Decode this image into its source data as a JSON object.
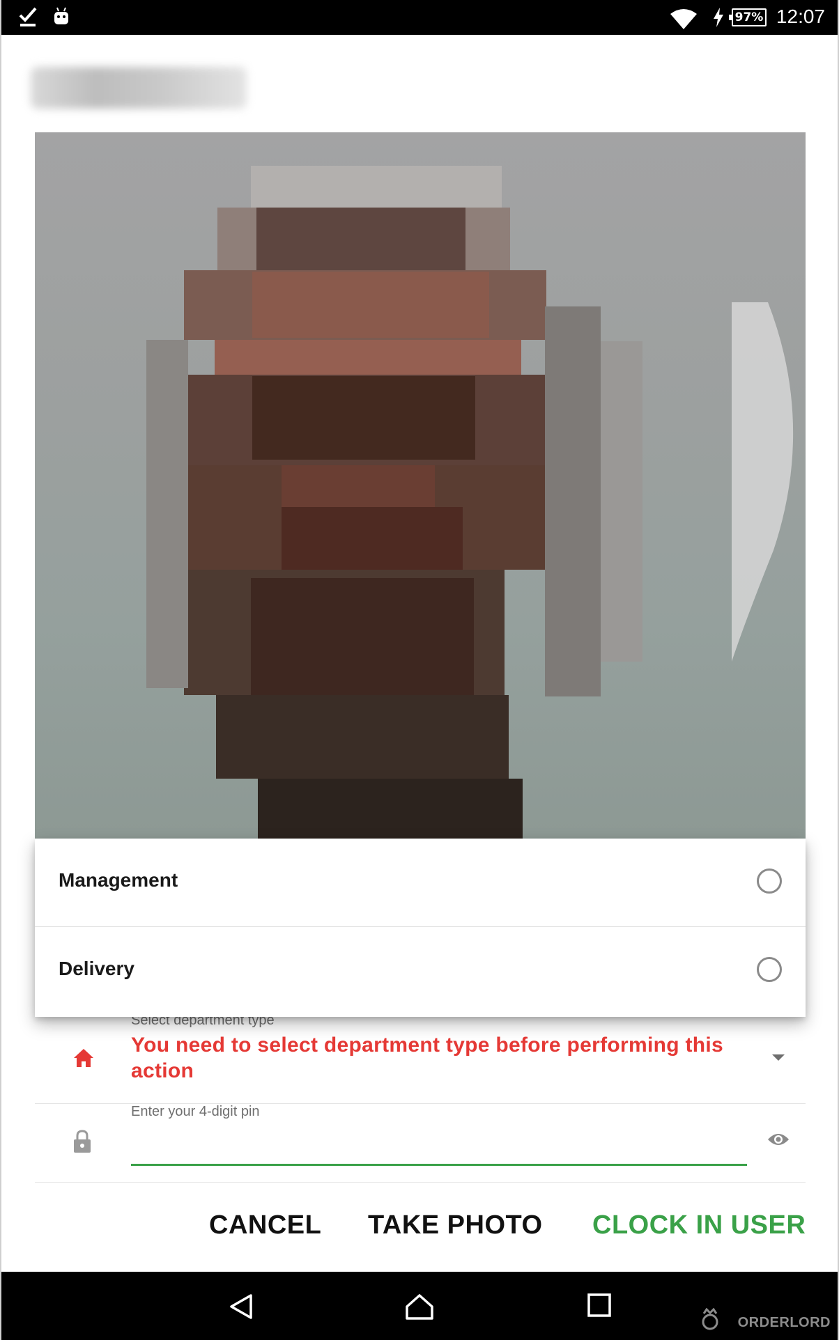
{
  "status_bar": {
    "battery": "97%",
    "time": "12:07"
  },
  "departments": {
    "options": [
      {
        "label": "Management",
        "selected": false
      },
      {
        "label": "Delivery",
        "selected": false
      }
    ]
  },
  "form": {
    "department_caption": "Select department type",
    "department_error": "You need to select department type before performing this action",
    "pin_caption": "Enter your 4-digit pin",
    "pin_value": ""
  },
  "actions": {
    "cancel": "CANCEL",
    "take_photo": "TAKE PHOTO",
    "clock_in": "CLOCK IN USER"
  },
  "watermark": "ORDERLORD",
  "colors": {
    "accent_green": "#3aa148",
    "error_red": "#e53935"
  }
}
